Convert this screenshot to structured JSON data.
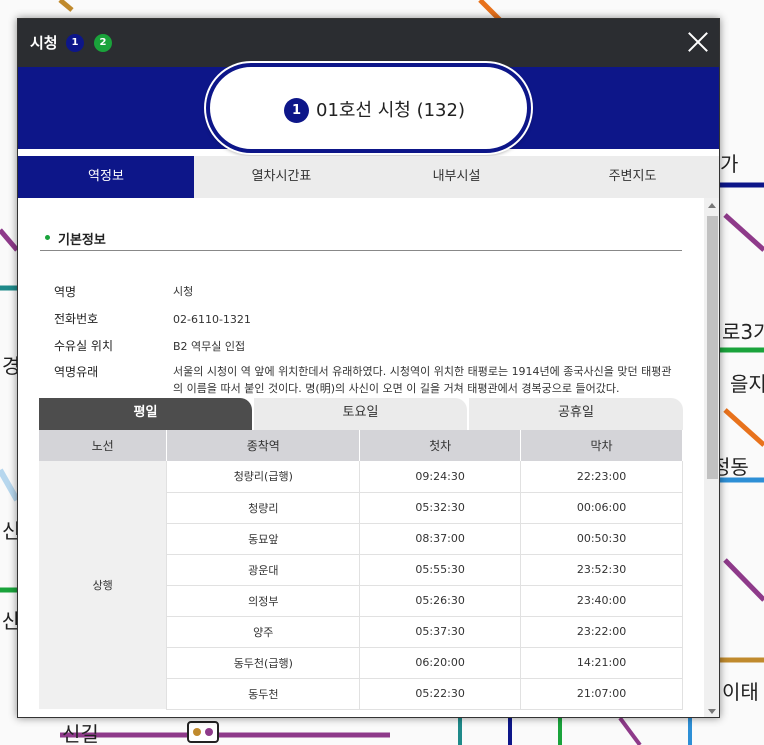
{
  "window": {
    "title": "시청",
    "lines": [
      {
        "label": "1",
        "color": "#0d1689"
      },
      {
        "label": "2",
        "color": "#1aa33b"
      }
    ]
  },
  "station": {
    "line_badge": "1",
    "name": "01호선 시청 (132)"
  },
  "tabs": [
    "역정보",
    "열차시간표",
    "내부시설",
    "주변지도"
  ],
  "basic_info": {
    "section_title": "기본정보",
    "rows": [
      {
        "label": "역명",
        "value": "시청"
      },
      {
        "label": "전화번호",
        "value": "02-6110-1321"
      },
      {
        "label": "수유실 위치",
        "value": "B2 역무실 인접"
      },
      {
        "label": "역명유래",
        "value": "서울의 시청이 역 앞에 위치한데서 유래하였다. 시청역이 위치한 태평로는 1914년에 종국사신을 맞던 태평관의 이름을 따서 붙인 것이다. 명(明)의 사신이 오면 이 길을 거쳐 태평관에서 경복궁으로 들어갔다."
      }
    ]
  },
  "day_tabs": [
    "평일",
    "토요일",
    "공휴일"
  ],
  "timetable": {
    "headers": [
      "노선",
      "종착역",
      "첫차",
      "막차"
    ],
    "direction": "상행",
    "rows": [
      {
        "dest": "청량리(급행)",
        "first": "09:24:30",
        "last": "22:23:00"
      },
      {
        "dest": "청량리",
        "first": "05:32:30",
        "last": "00:06:00"
      },
      {
        "dest": "동묘앞",
        "first": "08:37:00",
        "last": "00:50:30"
      },
      {
        "dest": "광운대",
        "first": "05:55:30",
        "last": "23:52:30"
      },
      {
        "dest": "의정부",
        "first": "05:26:30",
        "last": "23:40:00"
      },
      {
        "dest": "양주",
        "first": "05:37:30",
        "last": "23:22:00"
      },
      {
        "dest": "동두천(급행)",
        "first": "06:20:00",
        "last": "14:21:00"
      },
      {
        "dest": "동두천",
        "first": "05:22:30",
        "last": "21:07:00"
      }
    ]
  },
  "map_labels": [
    "가",
    "로3가",
    "을지",
    "정동",
    "이태",
    "신길",
    "경",
    "신",
    "산"
  ]
}
